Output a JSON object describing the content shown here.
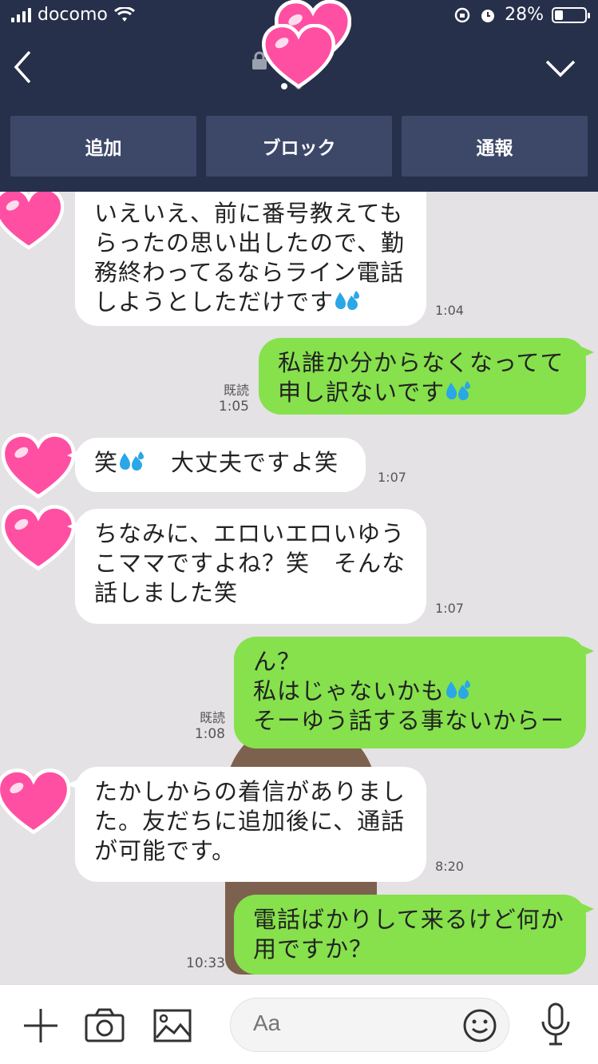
{
  "status_bar": {
    "carrier": "docomo",
    "battery_text": "28%",
    "battery_level": 0.28
  },
  "actions": {
    "add": "追加",
    "block": "ブロック",
    "report": "通報"
  },
  "messages": {
    "m1": {
      "lines": [
        "いえいえ、前に番号教えても",
        "らったの思い出したので、勤",
        "務終わってるならライン電話",
        "しようとしただけです"
      ],
      "time": "1:04"
    },
    "m2": {
      "lines": [
        "私誰か分からなくなってて",
        "申し訳ないです"
      ],
      "read": "既読",
      "time": "1:05"
    },
    "m3": {
      "part1": "笑",
      "part2": "大丈夫ですよ笑",
      "time": "1:07"
    },
    "m4": {
      "lines": [
        "ちなみに、エロいエロいゆう",
        "こママですよね？笑　そんな",
        "話しました笑"
      ],
      "time": "1:07"
    },
    "m5": {
      "lines": [
        "ん？",
        "私はじゃないかも",
        "そーゆう話する事ないからー"
      ],
      "read": "既読",
      "time": "1:08"
    },
    "m6": {
      "lines": [
        "たかしからの着信がありまし",
        "た。友だちに追加後に、通話",
        "が可能です。"
      ],
      "time": "8:20"
    },
    "m7": {
      "lines": [
        "電話ばかりして来るけど何か",
        "用ですか？"
      ],
      "time": "10:33"
    }
  },
  "input": {
    "placeholder": "Aa"
  },
  "icons": {
    "back": "chevron-left-icon",
    "menu": "chevron-down-icon",
    "lock": "lock-icon",
    "add": "plus-icon",
    "camera": "camera-icon",
    "image": "image-icon",
    "emoji": "smiley-icon",
    "mic": "microphone-icon",
    "sweat": "sweat-droplets-icon",
    "heart": "heart-sticker-icon"
  },
  "colors": {
    "header": "#26304a",
    "action_button": "#3d4869",
    "outgoing_bubble": "#86e14c",
    "incoming_bubble": "#ffffff",
    "heart": "#ff4fa3"
  }
}
